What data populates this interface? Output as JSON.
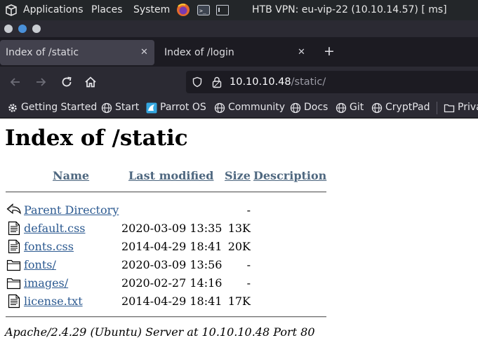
{
  "system_panel": {
    "menus": [
      "Applications",
      "Places",
      "System"
    ],
    "vpn_status": "HTB VPN: eu-vip-22 (10.10.14.57) [ ms]",
    "taskbar_icons": [
      "firefox-icon",
      "terminal-icon",
      "window-icon"
    ]
  },
  "tabs": [
    {
      "label": "Index of /static",
      "active": true
    },
    {
      "label": "Index of /login",
      "active": false
    }
  ],
  "nav": {
    "url_host": "10.10.10.48",
    "url_path": "/static/"
  },
  "bookmarks": [
    {
      "label": "Getting Started",
      "icon": "gear-icon"
    },
    {
      "label": "Start",
      "icon": "globe-icon"
    },
    {
      "label": "Parrot OS",
      "icon": "parrot-icon"
    },
    {
      "label": "Community",
      "icon": "globe-icon"
    },
    {
      "label": "Docs",
      "icon": "globe-icon"
    },
    {
      "label": "Git",
      "icon": "globe-icon"
    },
    {
      "label": "CryptPad",
      "icon": "globe-icon"
    },
    {
      "label": "Priva",
      "icon": "folder-icon"
    }
  ],
  "page": {
    "title": "Index of /static",
    "headers": {
      "name": "Name",
      "modified": "Last modified",
      "size": "Size",
      "description": "Description"
    },
    "rows": [
      {
        "name": "Parent Directory",
        "modified": "",
        "size": "-",
        "icon": "back-arrow-icon"
      },
      {
        "name": "default.css",
        "modified": "2020-03-09 13:35",
        "size": "13K",
        "icon": "text-file-icon"
      },
      {
        "name": "fonts.css",
        "modified": "2014-04-29 18:41",
        "size": "20K",
        "icon": "text-file-icon"
      },
      {
        "name": "fonts/",
        "modified": "2020-03-09 13:56",
        "size": "-",
        "icon": "folder-icon"
      },
      {
        "name": "images/",
        "modified": "2020-02-27 14:16",
        "size": "-",
        "icon": "folder-icon"
      },
      {
        "name": "license.txt",
        "modified": "2014-04-29 18:41",
        "size": "17K",
        "icon": "text-file-icon"
      }
    ],
    "address": "Apache/2.4.29 (Ubuntu) Server at 10.10.10.48 Port 80"
  },
  "colors": {
    "link": "#2c5a91",
    "header_link": "#4f6880",
    "panel_bg": "#232629",
    "toolbar_bg": "#2b2a33",
    "tabstrip_bg": "#1c1b22"
  }
}
